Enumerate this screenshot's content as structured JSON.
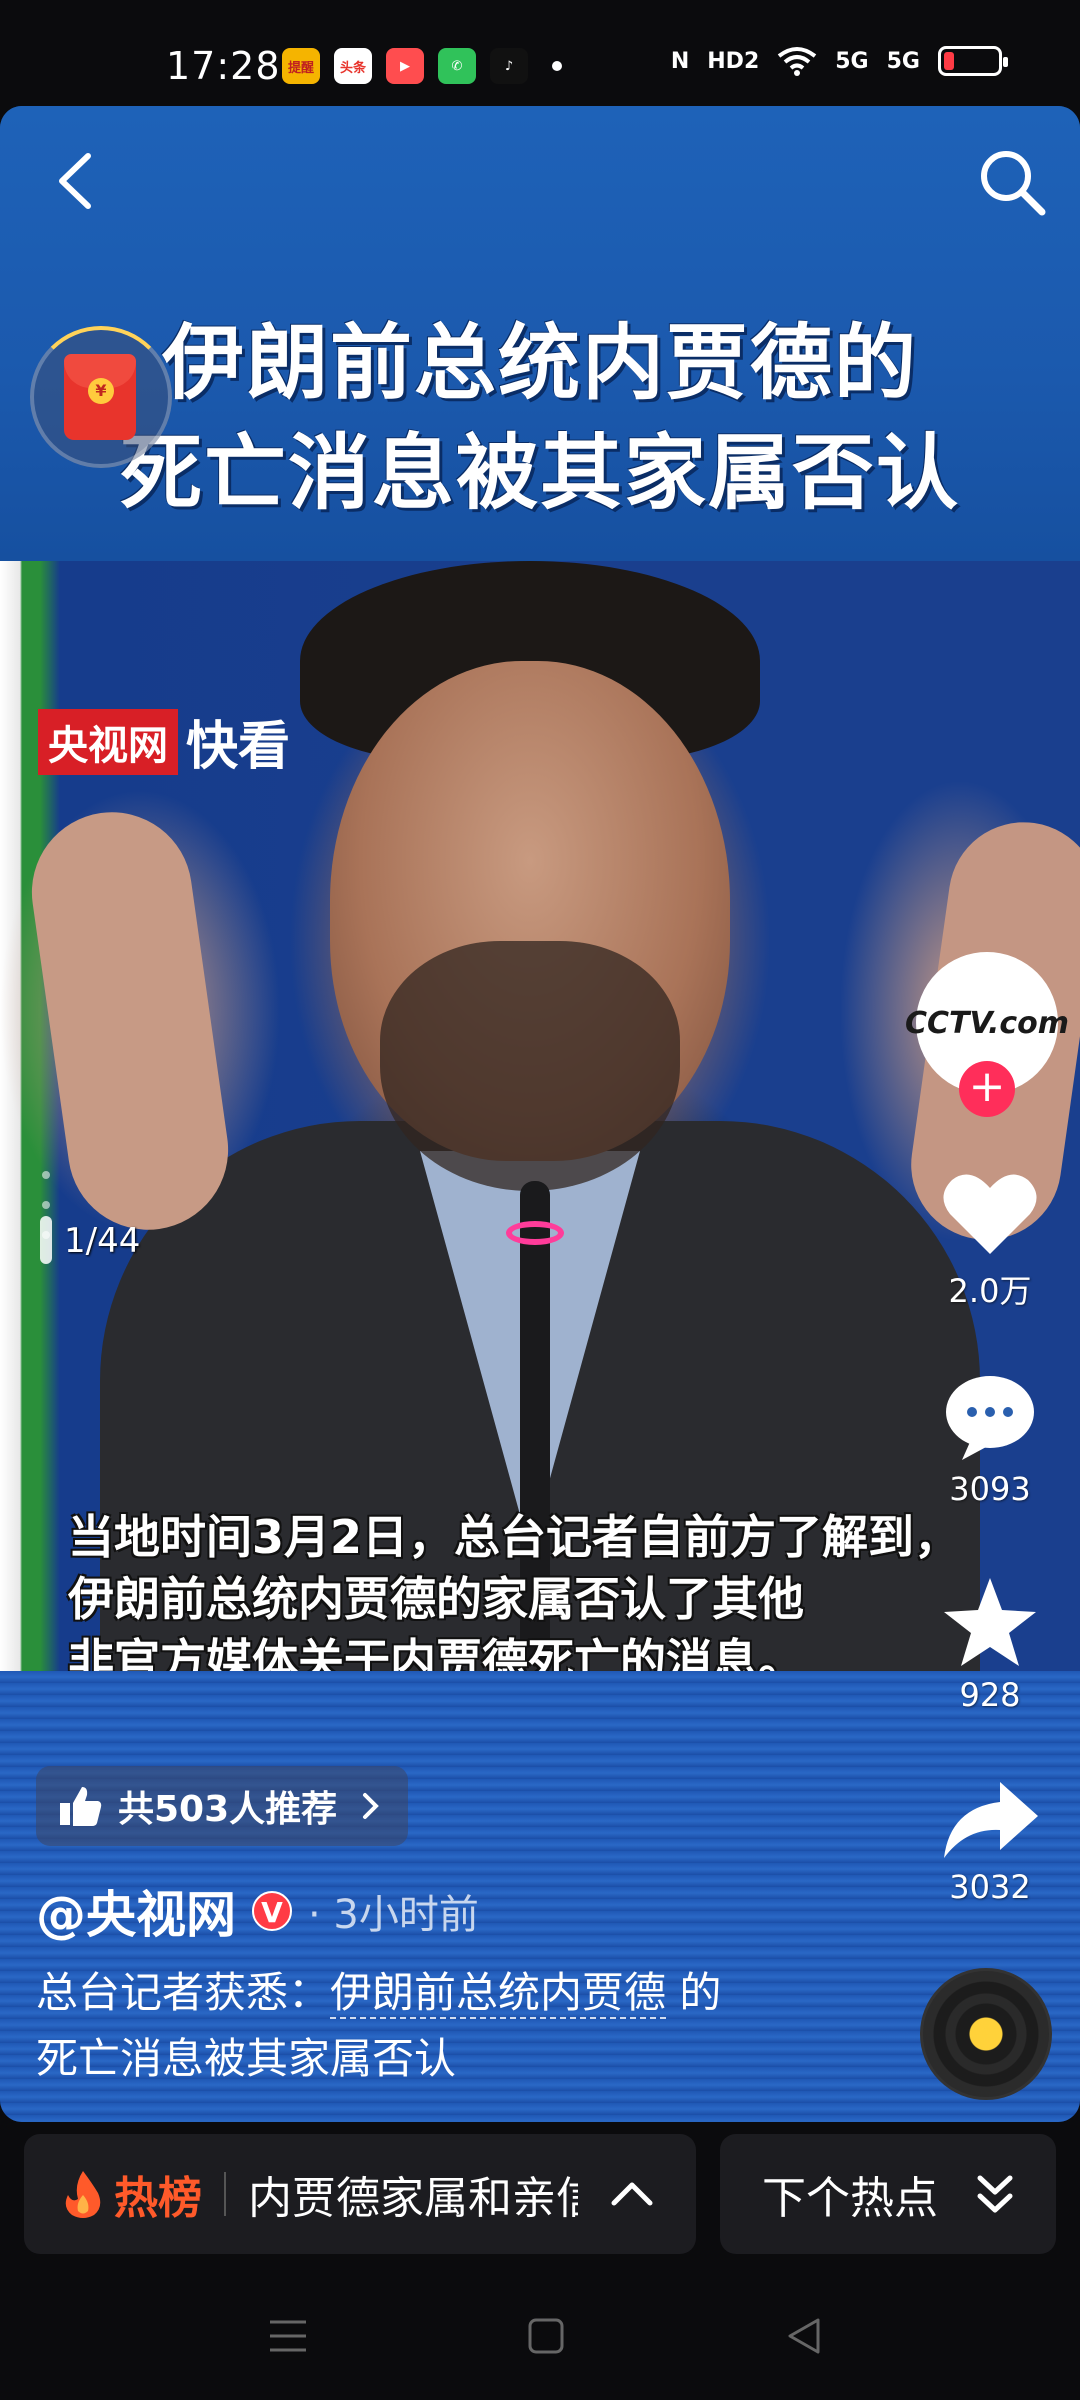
{
  "status_bar": {
    "time": "17:28",
    "apps": [
      {
        "name": "app-icon-1",
        "label": "提醒",
        "color": "#f5b400"
      },
      {
        "name": "toutiao-icon",
        "label": "头条",
        "color": "#e8342c"
      },
      {
        "name": "video-icon",
        "label": "▶",
        "color": "#ff4d4f"
      },
      {
        "name": "phone-icon",
        "label": "✆",
        "color": "#30c25a"
      },
      {
        "name": "tiktok-icon",
        "label": "♪",
        "color": "#111111"
      }
    ],
    "network": [
      "N",
      "HD2",
      "5G",
      "5G"
    ]
  },
  "header": {
    "title_line1": "伊朗前总统内贾德的",
    "title_line2": "死亡消息被其家属否认"
  },
  "photo": {
    "logo_text": "央视网",
    "logo_suffix": "快看",
    "page_indicator": "1/44",
    "caption_lines": [
      "当地时间3月2日，总台记者自前方了解到，",
      "伊朗前总统内贾德的家属否认了其他",
      "非官方媒体关于内贾德死亡的消息。"
    ]
  },
  "actions": {
    "avatar_text": "CCTV.com",
    "follow": "+",
    "likes": "2.0万",
    "comments": "3093",
    "favorites": "928",
    "shares": "3032"
  },
  "post": {
    "recommend_label": "共503人推荐",
    "author": "@央视网",
    "verified_badge": "V",
    "time": "· 3小时前",
    "desc_prefix": "总台记者获悉：",
    "desc_topic": "伊朗前总统内贾德",
    "desc_suffix": " 的",
    "desc_line2": "死亡消息被其家属否认"
  },
  "hot_bar": {
    "label": "热榜",
    "topic": "内贾德家属和亲信",
    "next_label": "下个热点"
  },
  "colors": {
    "accent_red": "#ff2e5a",
    "hot_orange": "#ff5a2a",
    "banner_blue": "#1b59ad"
  }
}
